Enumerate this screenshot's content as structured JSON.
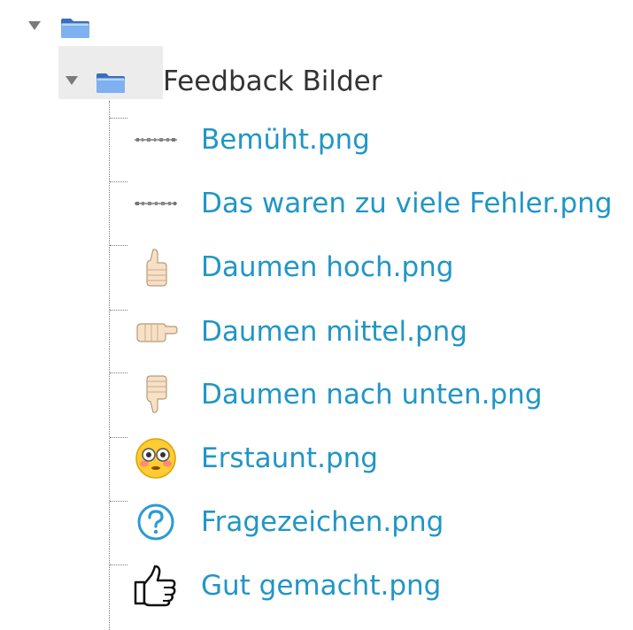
{
  "tree": {
    "root": {
      "expanded": true,
      "icon": "folder-icon"
    },
    "folder": {
      "label": "Feedback Bilder",
      "expanded": true,
      "icon": "folder-icon"
    },
    "files": [
      {
        "name": "Bemüht.png",
        "thumb": "bemueht-thumbnail",
        "thumb_text": "Bemüht, du bist auf dem richtigen Weg!"
      },
      {
        "name": "Das waren zu viele Fehler.png",
        "thumb": "fehler-thumbnail",
        "thumb_text": "Das waren zu viele Fehler!"
      },
      {
        "name": "Daumen hoch.png",
        "thumb": "thumbs-up-icon"
      },
      {
        "name": "Daumen mittel.png",
        "thumb": "thumb-sideways-icon"
      },
      {
        "name": "Daumen nach unten.png",
        "thumb": "thumbs-down-icon"
      },
      {
        "name": "Erstaunt.png",
        "thumb": "flushed-face-icon"
      },
      {
        "name": "Fragezeichen.png",
        "thumb": "question-mark-icon"
      },
      {
        "name": "Gut gemacht.png",
        "thumb": "thumbs-up-outline-icon"
      }
    ]
  },
  "colors": {
    "link": "#2196c6",
    "folder": "#5a8fd8",
    "connector": "#7a7a7a"
  }
}
